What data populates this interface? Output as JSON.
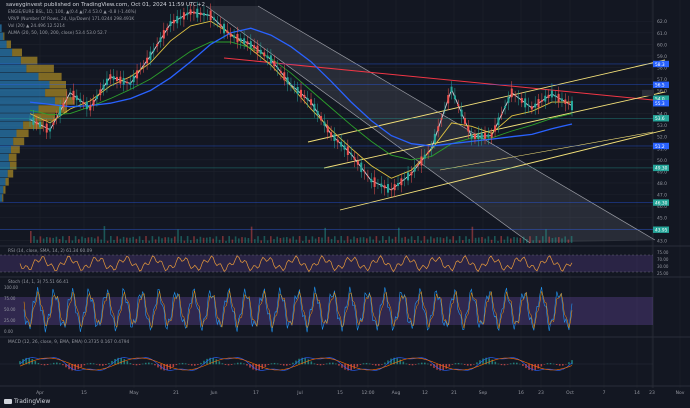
{
  "header": {
    "publish_line": "saveyginvest published on TradingView.com, Oct 01, 2024 11:59 UTC+2"
  },
  "indicator_labels": {
    "price_line": "ENGIE/EURE BSL, 1D, 100, ▲(0.4 ▲(7.4 53.0 ▲ -0.8 (-1.46%)",
    "vrvp": "VRVP (Number Of Rows, 24, Up/Down) 171.0244 298.491K",
    "vol": "Vol (20) ▲ 24.496 12.5214",
    "alma": "ALMA (20, 50, 100, 200, close) 53.4 53.0 52.7",
    "rsi": "RSI (14, close, SMA, 14, 2) 61.34 60.09",
    "stoch": "Stoch (14, 1, 3) 75.51 66.41",
    "macd": "MACD (12, 26, close, 9, EMA, EMA) 0.3735 0.167 0.4794"
  },
  "watermark": "TradingView",
  "colors": {
    "background": "#131722",
    "grid": "#1e222d",
    "up": "#26a69a",
    "down": "#ef5350",
    "vrvp_up": "#2f9ae0",
    "vrvp_down": "#c9a227",
    "channel_fill": "#787b86",
    "trendlines": "#f5e27a",
    "resistance": "#f23645",
    "horizontal": "#2962ff",
    "rsi": "#e89a3b",
    "rsi_band": "#7e57c2",
    "stoch_k": "#2196f3",
    "stoch_d": "#ff9800",
    "macd": "#2962ff",
    "signal": "#ff6d00"
  },
  "chart_data": {
    "type": "line",
    "title": "saveyginvest published on TradingView.com, Oct 01, 2024 11:59 UTC+2",
    "x_ticks": [
      "Apr",
      "15",
      "May",
      "21",
      "Jun",
      "17",
      "Jul",
      "15",
      "12:00",
      "Aug",
      "12",
      "21",
      "Sep",
      "16",
      "23",
      "Oct",
      "7",
      "14",
      "23",
      "Nov"
    ],
    "y_ticks": [
      62.0,
      61.0,
      60.0,
      59.0,
      58.0,
      57.0,
      56.0,
      55.0,
      54.0,
      53.0,
      52.0,
      51.0,
      50.0,
      49.0,
      48.0,
      47.0,
      46.0,
      45.0,
      44.0,
      43.0
    ],
    "ylim": [
      42.8,
      62.8
    ],
    "price_tags": [
      {
        "label": "58.3",
        "value": 58.3,
        "color": "#2962ff"
      },
      {
        "label": "56.5",
        "value": 56.5,
        "color": "#2962ff"
      },
      {
        "label": "54.0",
        "value": 55.3,
        "color": "#26a69a"
      },
      {
        "label": "55.3",
        "value": 54.9,
        "color": "#2962ff"
      },
      {
        "label": "53.6",
        "value": 53.6,
        "color": "#26a69a"
      },
      {
        "label": "51.2",
        "value": 51.2,
        "color": "#2962ff"
      },
      {
        "label": "49.30",
        "value": 49.3,
        "color": "#26a69a"
      },
      {
        "label": "46.30",
        "value": 46.3,
        "color": "#26a69a"
      },
      {
        "label": "43.95",
        "value": 43.95,
        "color": "#26a69a"
      }
    ],
    "series": [
      {
        "name": "ENGIE",
        "values": [
          53.5,
          52.6,
          55.8,
          54.5,
          57.2,
          56.6,
          59.0,
          61.8,
          62.8,
          62.5,
          60.8,
          60.0,
          58.7,
          56.5,
          55.0,
          52.2,
          50.5,
          48.2,
          47.4,
          48.8,
          51.0,
          56.1,
          52.0,
          52.1,
          55.8,
          54.5,
          55.7,
          54.7
        ]
      },
      {
        "name": "ALMA 20",
        "values": [
          54.0,
          53.2,
          54.4,
          55.1,
          56.4,
          57.2,
          58.4,
          60.3,
          61.6,
          62.0,
          60.9,
          59.6,
          58.2,
          56.4,
          54.4,
          52.6,
          51.0,
          49.5,
          48.4,
          49.1,
          50.9,
          53.2,
          52.9,
          52.3,
          53.8,
          54.2,
          55.0,
          55.0
        ]
      },
      {
        "name": "ALMA 50",
        "values": [
          54.3,
          53.9,
          54.0,
          54.6,
          55.3,
          56.1,
          57.0,
          58.2,
          59.4,
          60.2,
          60.2,
          59.7,
          58.8,
          57.5,
          56.0,
          54.5,
          53.0,
          51.6,
          50.4,
          50.0,
          50.3,
          51.4,
          51.9,
          51.9,
          52.5,
          53.0,
          53.6,
          54.0
        ]
      },
      {
        "name": "ALMA 100",
        "values": [
          55.0,
          54.8,
          54.6,
          54.7,
          54.9,
          55.3,
          56.0,
          57.1,
          58.5,
          60.0,
          61.0,
          61.4,
          60.8,
          59.8,
          58.5,
          56.8,
          55.0,
          53.4,
          52.1,
          51.4,
          51.2,
          51.4,
          51.6,
          51.8,
          52.0,
          52.2,
          52.7,
          53.1
        ]
      }
    ]
  }
}
